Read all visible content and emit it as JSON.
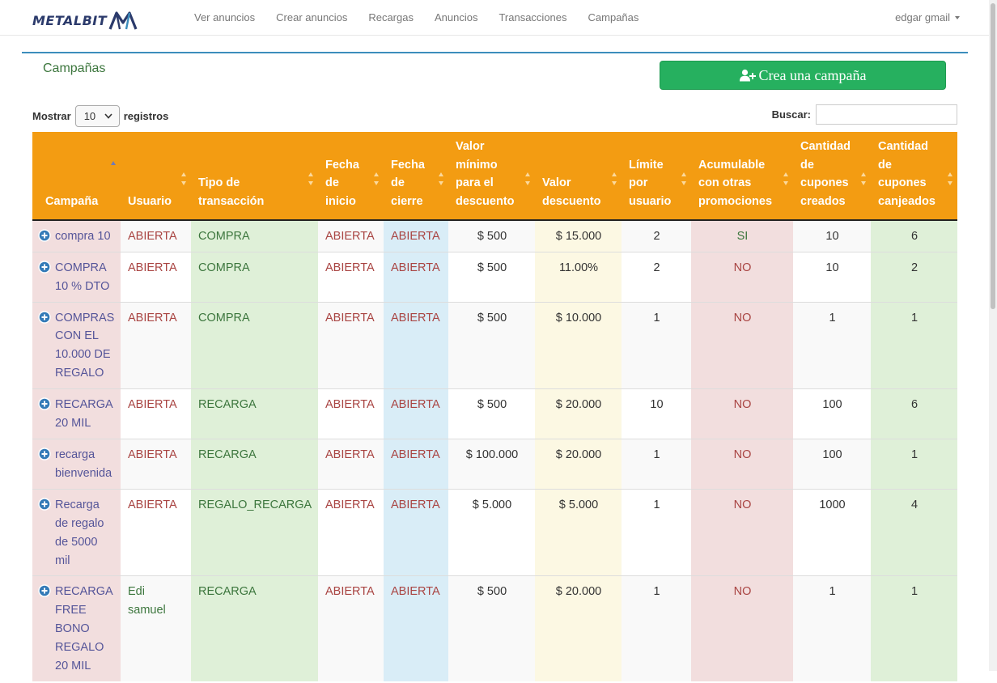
{
  "brand": {
    "name": "METALBIT"
  },
  "nav": {
    "links": [
      {
        "label": "Ver anuncios"
      },
      {
        "label": "Crear anuncios"
      },
      {
        "label": "Recargas"
      },
      {
        "label": "Anuncios"
      },
      {
        "label": "Transacciones"
      },
      {
        "label": "Campañas"
      }
    ],
    "user": "edgar gmail"
  },
  "page": {
    "title": "Campañas",
    "create_button": "Crea una campaña"
  },
  "table_controls": {
    "show_label": "Mostrar",
    "page_size": "10",
    "records_label": "registros",
    "search_label": "Buscar:",
    "search_value": ""
  },
  "table": {
    "columns": [
      "Campaña",
      "Usuario",
      "Tipo de transacción",
      "Fecha de inicio",
      "Fecha de cierre",
      "Valor mínimo para el descuento",
      "Valor descuento",
      "Límite por usuario",
      "Acumulable con otras promociones",
      "Cantidad de cupones creados",
      "Cantidad de cupones canjeados"
    ],
    "sorted_column": "Campaña",
    "sort_direction": "ascending",
    "rows": [
      {
        "campaign": "compra 10",
        "user": "ABIERTA",
        "type": "COMPRA",
        "start": "ABIERTA",
        "end": "ABIERTA",
        "min_value": "$ 500",
        "discount": "$ 15.000",
        "limit": "2",
        "cumulative": "SI",
        "created": "10",
        "redeemed": "6"
      },
      {
        "campaign": "COMPRA 10 % DTO",
        "user": "ABIERTA",
        "type": "COMPRA",
        "start": "ABIERTA",
        "end": "ABIERTA",
        "min_value": "$ 500",
        "discount": "11.00%",
        "limit": "2",
        "cumulative": "NO",
        "created": "10",
        "redeemed": "2"
      },
      {
        "campaign": "COMPRAS CON EL 10.000 DE REGALO",
        "user": "ABIERTA",
        "type": "COMPRA",
        "start": "ABIERTA",
        "end": "ABIERTA",
        "min_value": "$ 500",
        "discount": "$ 10.000",
        "limit": "1",
        "cumulative": "NO",
        "created": "1",
        "redeemed": "1"
      },
      {
        "campaign": "RECARGA 20 MIL",
        "user": "ABIERTA",
        "type": "RECARGA",
        "start": "ABIERTA",
        "end": "ABIERTA",
        "min_value": "$ 500",
        "discount": "$ 20.000",
        "limit": "10",
        "cumulative": "NO",
        "created": "100",
        "redeemed": "6"
      },
      {
        "campaign": "recarga bienvenida",
        "user": "ABIERTA",
        "type": "RECARGA",
        "start": "ABIERTA",
        "end": "ABIERTA",
        "min_value": "$ 100.000",
        "discount": "$ 20.000",
        "limit": "1",
        "cumulative": "NO",
        "created": "100",
        "redeemed": "1"
      },
      {
        "campaign": "Recarga de regalo de 5000 mil",
        "user": "ABIERTA",
        "type": "REGALO_RECARGA",
        "start": "ABIERTA",
        "end": "ABIERTA",
        "min_value": "$ 5.000",
        "discount": "$ 5.000",
        "limit": "1",
        "cumulative": "NO",
        "created": "1000",
        "redeemed": "4"
      },
      {
        "campaign": "RECARGA FREE BONO REGALO 20 MIL",
        "user": "Edi samuel",
        "type": "RECARGA",
        "start": "ABIERTA",
        "end": "ABIERTA",
        "min_value": "$ 500",
        "discount": "$ 20.000",
        "limit": "1",
        "cumulative": "NO",
        "created": "1",
        "redeemed": "1"
      }
    ]
  }
}
